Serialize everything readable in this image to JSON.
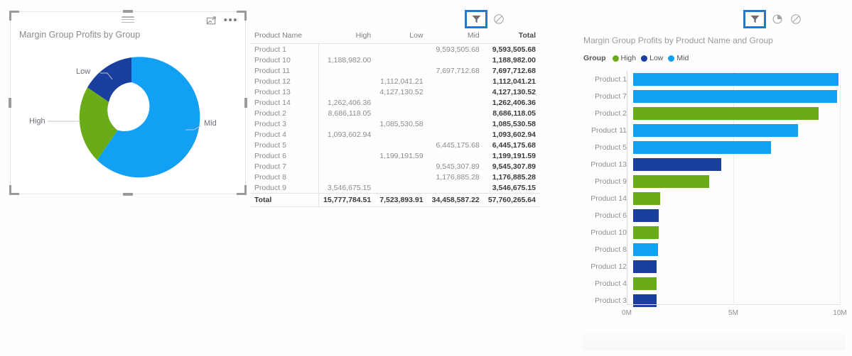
{
  "donut_visual": {
    "title": "Margin Group Profits by Group",
    "drag_handle": "drag-handle",
    "focus_icon": "focus-mode-icon",
    "more_icon": "•••",
    "labels": {
      "low": "Low",
      "high": "High",
      "mid": "Mid"
    }
  },
  "table_visual": {
    "icons": {
      "filter": "filter-icon",
      "block": "no-entry-icon"
    },
    "columns": [
      "Product Name",
      "High",
      "Low",
      "Mid",
      "Total"
    ],
    "rows": [
      {
        "name": "Product 1",
        "high": "",
        "low": "",
        "mid": "9,593,505.68",
        "total": "9,593,505.68"
      },
      {
        "name": "Product 10",
        "high": "1,188,982.00",
        "low": "",
        "mid": "",
        "total": "1,188,982.00"
      },
      {
        "name": "Product 11",
        "high": "",
        "low": "",
        "mid": "7,697,712.68",
        "total": "7,697,712.68"
      },
      {
        "name": "Product 12",
        "high": "",
        "low": "1,112,041.21",
        "mid": "",
        "total": "1,112,041.21"
      },
      {
        "name": "Product 13",
        "high": "",
        "low": "4,127,130.52",
        "mid": "",
        "total": "4,127,130.52"
      },
      {
        "name": "Product 14",
        "high": "1,262,406.36",
        "low": "",
        "mid": "",
        "total": "1,262,406.36"
      },
      {
        "name": "Product 2",
        "high": "8,686,118.05",
        "low": "",
        "mid": "",
        "total": "8,686,118.05"
      },
      {
        "name": "Product 3",
        "high": "",
        "low": "1,085,530.58",
        "mid": "",
        "total": "1,085,530.58"
      },
      {
        "name": "Product 4",
        "high": "1,093,602.94",
        "low": "",
        "mid": "",
        "total": "1,093,602.94"
      },
      {
        "name": "Product 5",
        "high": "",
        "low": "",
        "mid": "6,445,175.68",
        "total": "6,445,175.68"
      },
      {
        "name": "Product 6",
        "high": "",
        "low": "1,199,191.59",
        "mid": "",
        "total": "1,199,191.59"
      },
      {
        "name": "Product 7",
        "high": "",
        "low": "",
        "mid": "9,545,307.89",
        "total": "9,545,307.89"
      },
      {
        "name": "Product 8",
        "high": "",
        "low": "",
        "mid": "1,176,885.28",
        "total": "1,176,885.28"
      },
      {
        "name": "Product 9",
        "high": "3,546,675.15",
        "low": "",
        "mid": "",
        "total": "3,546,675.15"
      }
    ],
    "total_row": {
      "name": "Total",
      "high": "15,777,784.51",
      "low": "7,523,893.91",
      "mid": "34,458,587.22",
      "total": "57,760,265.64"
    }
  },
  "bar_visual": {
    "title": "Margin Group Profits by Product Name and Group",
    "icons": {
      "filter": "filter-icon",
      "pie": "pie-chart-icon",
      "block": "no-entry-icon"
    },
    "legend_title": "Group"
  },
  "colors": {
    "high": "#6aac18",
    "low": "#1b3f9e",
    "mid": "#12a0f5",
    "selection_blue": "#1b7ad1"
  },
  "chart_data": [
    {
      "type": "pie",
      "title": "Margin Group Profits by Group",
      "labels": [
        "Mid",
        "High",
        "Low"
      ],
      "values": [
        34458587.22,
        15777784.51,
        7523893.91
      ],
      "colors": [
        "#12a0f5",
        "#6aac18",
        "#1b3f9e"
      ],
      "donut": true,
      "legend": "none",
      "data_labels": "category-name-callouts"
    },
    {
      "type": "bar",
      "orientation": "horizontal",
      "title": "Margin Group Profits by Product Name and Group",
      "xlabel": "",
      "ylabel": "",
      "xlim": [
        0,
        10000000
      ],
      "xticks": [
        "0M",
        "5M",
        "10M"
      ],
      "xtick_values": [
        0,
        5000000,
        10000000
      ],
      "grid": true,
      "legend": "top",
      "legend_entries": [
        {
          "name": "High",
          "color": "#6aac18"
        },
        {
          "name": "Low",
          "color": "#1b3f9e"
        },
        {
          "name": "Mid",
          "color": "#12a0f5"
        }
      ],
      "categories": [
        "Product 1",
        "Product 7",
        "Product 2",
        "Product 11",
        "Product 5",
        "Product 13",
        "Product 9",
        "Product 14",
        "Product 6",
        "Product 10",
        "Product 8",
        "Product 12",
        "Product 4",
        "Product 3"
      ],
      "values": [
        9593505.68,
        9545307.89,
        8686118.05,
        7697712.68,
        6445175.68,
        4127130.52,
        3546675.15,
        1262406.36,
        1199191.59,
        1188982.0,
        1176885.28,
        1112041.21,
        1093602.94,
        1085530.58
      ],
      "group": [
        "Mid",
        "Mid",
        "High",
        "Mid",
        "Mid",
        "Low",
        "High",
        "High",
        "Low",
        "High",
        "Mid",
        "Low",
        "High",
        "Low"
      ]
    },
    {
      "type": "table",
      "title": "Margin Group Profits table",
      "columns": [
        "Product Name",
        "High",
        "Low",
        "Mid",
        "Total"
      ],
      "rows": [
        [
          "Product 1",
          null,
          null,
          9593505.68,
          9593505.68
        ],
        [
          "Product 10",
          1188982.0,
          null,
          null,
          1188982.0
        ],
        [
          "Product 11",
          null,
          null,
          7697712.68,
          7697712.68
        ],
        [
          "Product 12",
          null,
          1112041.21,
          null,
          1112041.21
        ],
        [
          "Product 13",
          null,
          4127130.52,
          null,
          4127130.52
        ],
        [
          "Product 14",
          1262406.36,
          null,
          null,
          1262406.36
        ],
        [
          "Product 2",
          8686118.05,
          null,
          null,
          8686118.05
        ],
        [
          "Product 3",
          null,
          1085530.58,
          null,
          1085530.58
        ],
        [
          "Product 4",
          1093602.94,
          null,
          null,
          1093602.94
        ],
        [
          "Product 5",
          null,
          null,
          6445175.68,
          6445175.68
        ],
        [
          "Product 6",
          null,
          1199191.59,
          null,
          1199191.59
        ],
        [
          "Product 7",
          null,
          null,
          9545307.89,
          9545307.89
        ],
        [
          "Product 8",
          null,
          null,
          1176885.28,
          1176885.28
        ],
        [
          "Product 9",
          3546675.15,
          null,
          null,
          3546675.15
        ]
      ],
      "totals": [
        "Total",
        15777784.51,
        7523893.91,
        34458587.22,
        57760265.64
      ]
    }
  ]
}
